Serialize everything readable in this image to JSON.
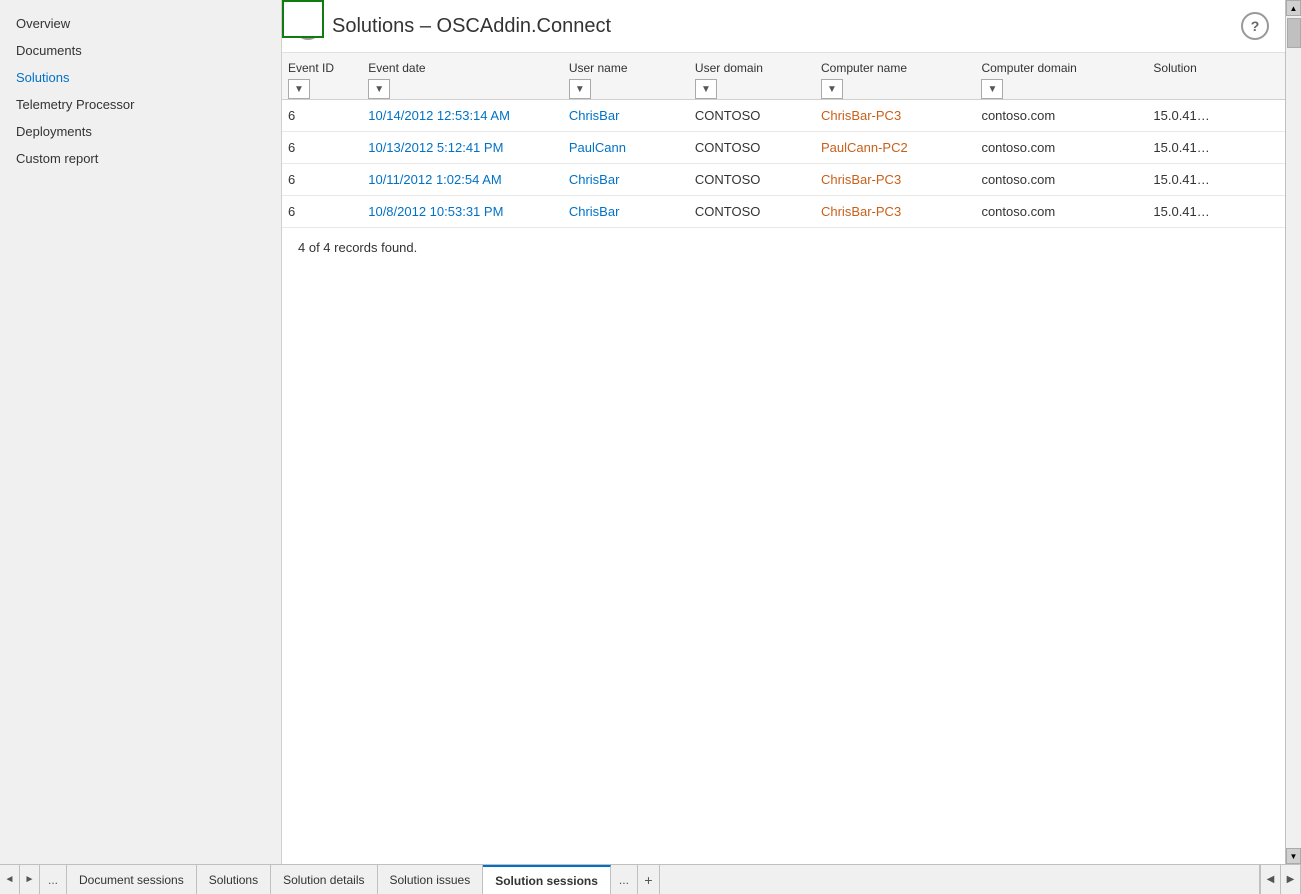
{
  "sidebar": {
    "items": [
      {
        "id": "overview",
        "label": "Overview",
        "active": false
      },
      {
        "id": "documents",
        "label": "Documents",
        "active": false
      },
      {
        "id": "solutions",
        "label": "Solutions",
        "active": true
      },
      {
        "id": "telemetry-processor",
        "label": "Telemetry Processor",
        "active": false
      },
      {
        "id": "deployments",
        "label": "Deployments",
        "active": false
      },
      {
        "id": "custom-report",
        "label": "Custom report",
        "active": false
      }
    ]
  },
  "header": {
    "title": "Solutions – OSCAddin.Connect",
    "back_label": "←",
    "help_label": "?"
  },
  "table": {
    "columns": [
      {
        "id": "event-id",
        "label": "Event ID"
      },
      {
        "id": "event-date",
        "label": "Event date"
      },
      {
        "id": "user-name",
        "label": "User name"
      },
      {
        "id": "user-domain",
        "label": "User domain"
      },
      {
        "id": "computer-name",
        "label": "Computer name"
      },
      {
        "id": "computer-domain",
        "label": "Computer domain"
      },
      {
        "id": "solution",
        "label": "Solution"
      }
    ],
    "rows": [
      {
        "event_id": "6",
        "event_date": "10/14/2012 12:53:14 AM",
        "user_name": "ChrisBar",
        "user_domain": "CONTOSO",
        "computer_name": "ChrisBar-PC3",
        "computer_domain": "contoso.com",
        "solution": "15.0.41…"
      },
      {
        "event_id": "6",
        "event_date": "10/13/2012 5:12:41 PM",
        "user_name": "PaulCann",
        "user_domain": "CONTOSO",
        "computer_name": "PaulCann-PC2",
        "computer_domain": "contoso.com",
        "solution": "15.0.41…"
      },
      {
        "event_id": "6",
        "event_date": "10/11/2012 1:02:54 AM",
        "user_name": "ChrisBar",
        "user_domain": "CONTOSO",
        "computer_name": "ChrisBar-PC3",
        "computer_domain": "contoso.com",
        "solution": "15.0.41…"
      },
      {
        "event_id": "6",
        "event_date": "10/8/2012 10:53:31 PM",
        "user_name": "ChrisBar",
        "user_domain": "CONTOSO",
        "computer_name": "ChrisBar-PC3",
        "computer_domain": "contoso.com",
        "solution": "15.0.41…"
      }
    ],
    "records_info": "4 of 4 records found."
  },
  "bottom_tabs": [
    {
      "id": "document-sessions",
      "label": "Document sessions",
      "active": false
    },
    {
      "id": "solutions",
      "label": "Solutions",
      "active": false
    },
    {
      "id": "solution-details",
      "label": "Solution details",
      "active": false
    },
    {
      "id": "solution-issues",
      "label": "Solution issues",
      "active": false
    },
    {
      "id": "solution-sessions",
      "label": "Solution sessions",
      "active": true
    }
  ],
  "bottom_nav": {
    "prev_label": "◄",
    "next_label": "►",
    "more_label": "...",
    "add_label": "+",
    "more2_label": "..."
  }
}
